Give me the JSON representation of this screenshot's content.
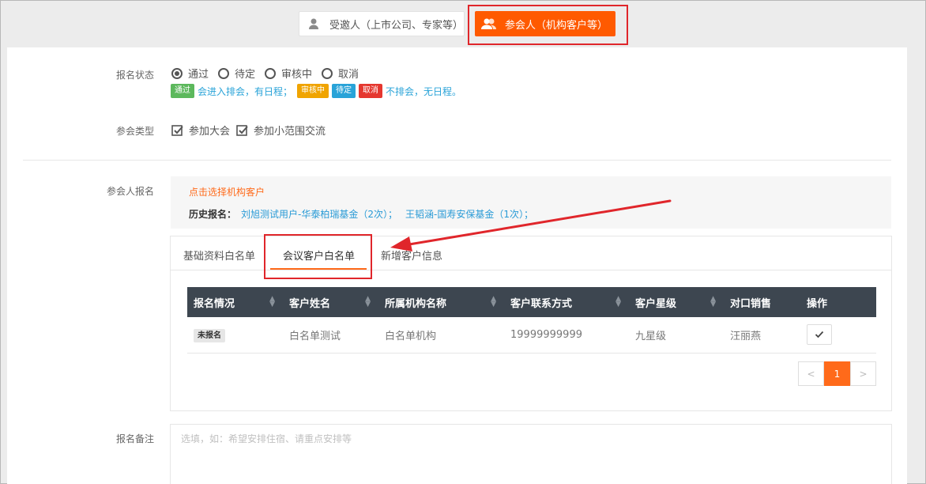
{
  "roles": {
    "invitee_label": "受邀人（上市公司、专家等）",
    "participant_label": "参会人（机构客户等）",
    "participant_color": "#ff5a00"
  },
  "form": {
    "status": {
      "label": "报名状态",
      "options": [
        "通过",
        "待定",
        "审核中",
        "取消"
      ],
      "selected": "通过",
      "legend": {
        "tag_pass": "通过",
        "text_pass": "会进入排会，有日程；",
        "tag_review": "审核中",
        "tag_pending": "待定",
        "tag_cancel": "取消",
        "text_other": "不排会，无日程。"
      }
    },
    "meeting_type": {
      "label": "参会类型",
      "options": [
        "参加大会",
        "参加小范围交流"
      ]
    },
    "participant": {
      "label": "参会人报名",
      "pick_link": "点击选择机构客户",
      "history_label": "历史报名：",
      "history": [
        "刘旭测试用户-华泰柏瑞基金（2次）；",
        "王韬涵-国寿安保基金（1次）；"
      ]
    },
    "remark": {
      "label": "报名备注",
      "placeholder": "选填，如：希望安排住宿、请重点安排等"
    }
  },
  "tabs": {
    "items": [
      "基础资料白名单",
      "会议客户白名单",
      "新增客户信息"
    ],
    "active": "会议客户白名单"
  },
  "table": {
    "headers": [
      "报名情况",
      "客户姓名",
      "所属机构名称",
      "客户联系方式",
      "客户星级",
      "对口销售",
      "操作"
    ],
    "rows": [
      {
        "status": "未报名",
        "name": "白名单测试",
        "org": "白名单机构",
        "phone": "19999999999",
        "star": "九星级",
        "sales": "汪丽燕"
      }
    ]
  },
  "pagination": {
    "prev": "<",
    "current": "1",
    "next": ">"
  },
  "colors": {
    "accent": "#ff6a1a",
    "tag_pass": "#5cb85c",
    "tag_review": "#f0a400",
    "tag_pending": "#29a3d8",
    "tag_cancel": "#e5372f",
    "annotation": "#e0262b"
  }
}
